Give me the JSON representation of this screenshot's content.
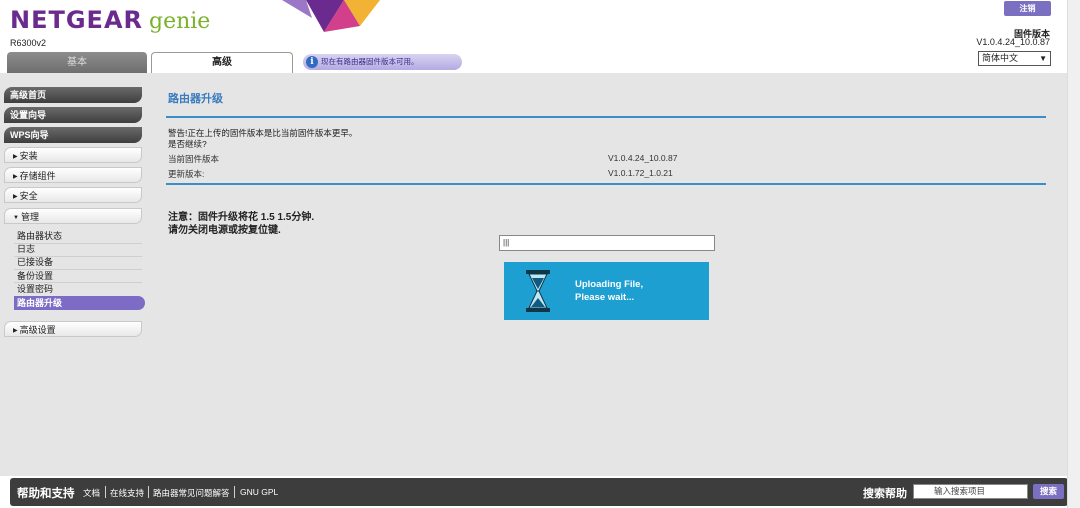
{
  "header": {
    "brand": "NETGEAR",
    "product": "genie",
    "model": "R6300v2",
    "logout_label": "注销",
    "firmware_label": "固件版本",
    "firmware_version": "V1.0.4.24_10.0.87",
    "language": "简体中文"
  },
  "tabs": [
    {
      "label": "基本",
      "active": false
    },
    {
      "label": "高级",
      "active": true
    }
  ],
  "notice": "现在有路由器固件版本可用。",
  "sidebar": {
    "top_items": [
      "高级首页",
      "设置向导",
      "WPS向导"
    ],
    "sections": [
      {
        "label": "安装",
        "expanded": false
      },
      {
        "label": "存储组件",
        "expanded": false
      },
      {
        "label": "安全",
        "expanded": false
      },
      {
        "label": "管理",
        "expanded": true
      }
    ],
    "sub_items": [
      "路由器状态",
      "日志",
      "已接设备",
      "备份设置",
      "设置密码",
      "路由器升级"
    ],
    "active_sub": "路由器升级",
    "advanced_label": "高级设置"
  },
  "main": {
    "title": "路由器升级",
    "warning_line1": "警告!正在上传的固件版本是比当前固件版本更早。",
    "warning_line2": "是否继续?",
    "rows": [
      {
        "label": "当前固件版本",
        "value": "V1.0.4.24_10.0.87"
      },
      {
        "label": "更新版本:",
        "value": "V1.0.1.72_1.0.21"
      }
    ],
    "note_line1": "注意：固件升级将花 1.5 1.5分钟.",
    "note_line2": "请勿关闭电源或按复位键.",
    "progress_text": "|||",
    "upload_line1": "Uploading File,",
    "upload_line2": "Please wait..."
  },
  "footer": {
    "title": "帮助和支持",
    "links": [
      "文档",
      "在线支持",
      "路由器常见问题解答",
      "GNU GPL"
    ],
    "search_title": "搜索帮助",
    "search_placeholder": "输入搜索项目",
    "search_button": "搜索"
  },
  "colors": {
    "brand_purple": "#6b2a8e",
    "genie_green": "#7bb12b",
    "accent_blue": "#3d8ec7",
    "upload_blue": "#1e9fd1",
    "button_purple": "#7b6fc2"
  }
}
